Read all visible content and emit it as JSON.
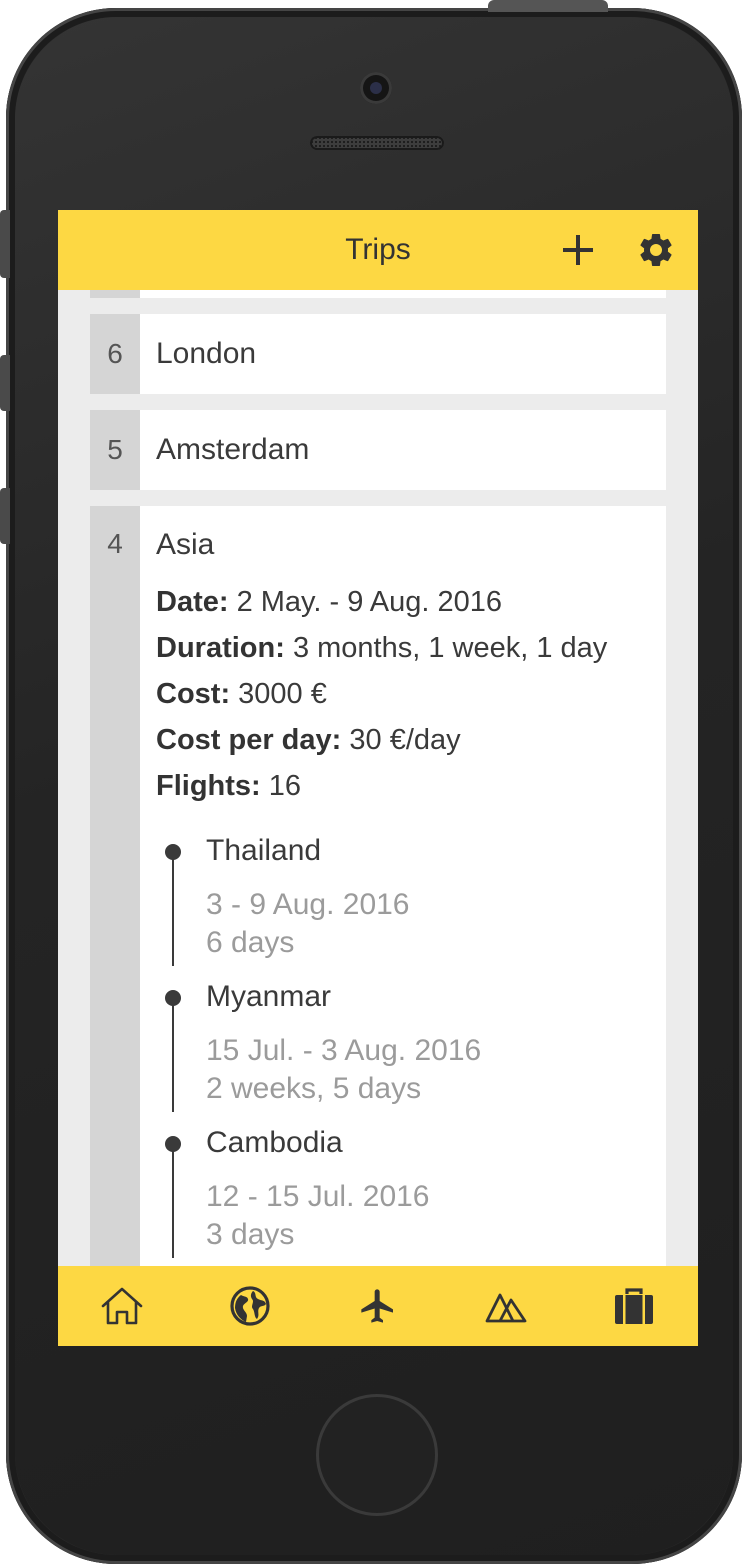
{
  "header": {
    "title": "Trips"
  },
  "trips": [
    {
      "number": "6",
      "name": "London"
    },
    {
      "number": "5",
      "name": "Amsterdam"
    },
    {
      "number": "4",
      "name": "Asia",
      "stats": {
        "date_label": "Date:",
        "date_value": "2 May. - 9 Aug. 2016",
        "duration_label": "Duration:",
        "duration_value": "3 months, 1 week, 1 day",
        "cost_label": "Cost:",
        "cost_value": "3000 €",
        "cost_per_day_label": "Cost per day:",
        "cost_per_day_value": "30 €/day",
        "flights_label": "Flights:",
        "flights_value": "16"
      },
      "stops": [
        {
          "name": "Thailand",
          "dates": "3 - 9 Aug. 2016",
          "duration": "6 days"
        },
        {
          "name": "Myanmar",
          "dates": "15 Jul. - 3 Aug. 2016",
          "duration": "2 weeks, 5 days"
        },
        {
          "name": "Cambodia",
          "dates": "12 - 15 Jul. 2016",
          "duration": "3 days"
        }
      ]
    }
  ],
  "tabs": [
    {
      "icon": "home-icon"
    },
    {
      "icon": "globe-icon"
    },
    {
      "icon": "airplane-icon"
    },
    {
      "icon": "mountains-icon"
    },
    {
      "icon": "suitcase-icon"
    }
  ],
  "colors": {
    "accent": "#fdd843",
    "text": "#3a3a3a",
    "muted": "#9b9b9b",
    "number_bg": "#d5d5d5"
  }
}
